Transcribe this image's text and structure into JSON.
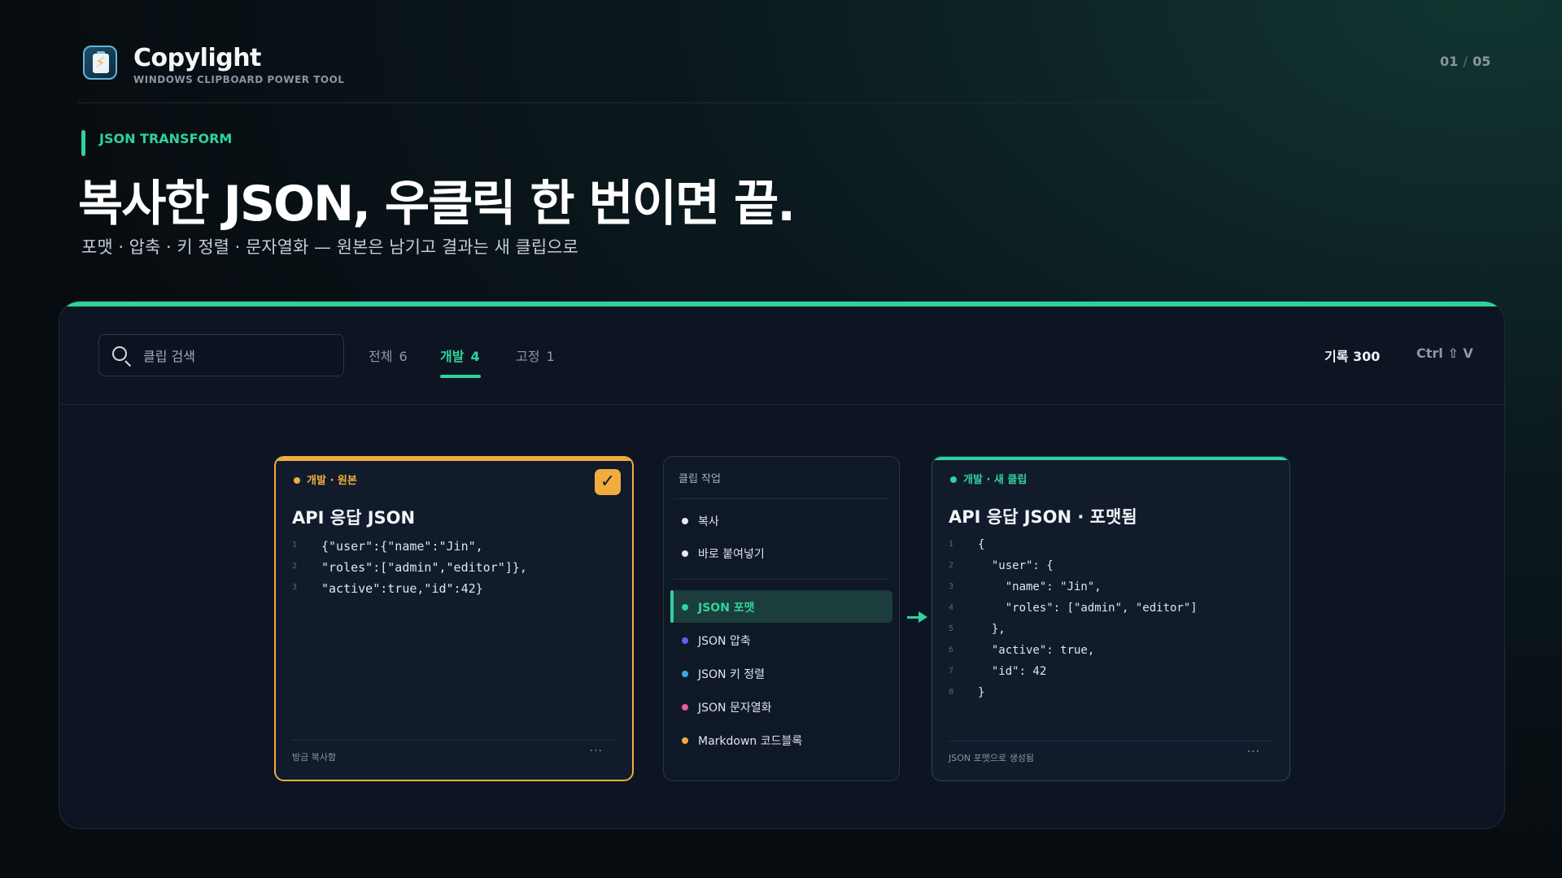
{
  "header": {
    "brand": "Copylight",
    "tagline": "WINDOWS CLIPBOARD POWER TOOL",
    "page_current": "01",
    "page_sep": "/",
    "page_total": "05"
  },
  "hero": {
    "section_label": "JSON TRANSFORM",
    "headline": "복사한 JSON, 우클릭 한 번이면 끝.",
    "subline": "포맷 · 압축 · 키 정렬 · 문자열화 — 원본은 남기고 결과는 새 클립으로"
  },
  "toolbar": {
    "search_placeholder": "클립 검색",
    "tabs": [
      {
        "label": "전체",
        "count": "6"
      },
      {
        "label": "개발",
        "count": "4"
      },
      {
        "label": "고정",
        "count": "1"
      }
    ],
    "active_tab": "개발",
    "history": "기록 300",
    "shortcut": "Ctrl ⇧ V"
  },
  "original_card": {
    "tag": "개발 · 원본",
    "title": "API 응답 JSON",
    "check": "✓",
    "lines": [
      {
        "n": "1",
        "text": "{\"user\":{\"name\":\"Jin\","
      },
      {
        "n": "2",
        "text": "\"roles\":[\"admin\",\"editor\"]},"
      },
      {
        "n": "3",
        "text": "\"active\":true,\"id\":42}"
      }
    ],
    "footer": "방금 복사함",
    "more": "···"
  },
  "menu": {
    "title": "클립 작업",
    "group1": [
      {
        "label": "복사",
        "color": "#e6ebf0"
      },
      {
        "label": "바로 붙여넣기",
        "color": "#e6ebf0"
      }
    ],
    "group2": [
      {
        "label": "JSON 포맷",
        "color": "#2fd39a",
        "active": true
      },
      {
        "label": "JSON 압축",
        "color": "#6a5cf0"
      },
      {
        "label": "JSON 키 정렬",
        "color": "#3aa8e8"
      },
      {
        "label": "JSON 문자열화",
        "color": "#ec5b8f"
      },
      {
        "label": "Markdown 코드블록",
        "color": "#f0ad3d"
      }
    ]
  },
  "new_card": {
    "tag": "개발 · 새 클립",
    "title": "API 응답 JSON · 포맷됨",
    "lines": [
      {
        "n": "1",
        "text": "{"
      },
      {
        "n": "2",
        "text": "  \"user\": {"
      },
      {
        "n": "3",
        "text": "    \"name\": \"Jin\","
      },
      {
        "n": "4",
        "text": "    \"roles\": [\"admin\", \"editor\"]"
      },
      {
        "n": "5",
        "text": "  },"
      },
      {
        "n": "6",
        "text": "  \"active\": true,"
      },
      {
        "n": "7",
        "text": "  \"id\": 42"
      },
      {
        "n": "8",
        "text": "}"
      }
    ],
    "footer": "JSON 포맷으로 생성됨",
    "more": "···"
  },
  "colors": {
    "accent": "#2fd39a",
    "original": "#f0ad3d",
    "panel": "#0d1523"
  }
}
